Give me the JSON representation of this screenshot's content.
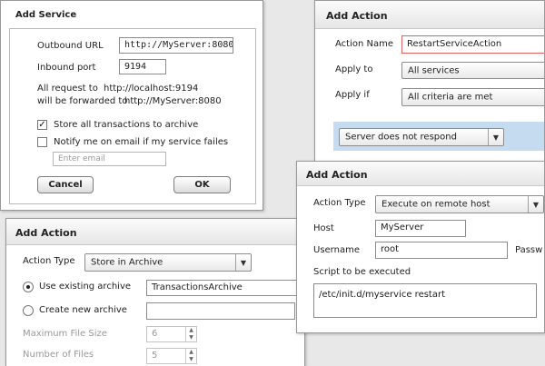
{
  "add_service": {
    "title": "Add Service",
    "outbound_label": "Outbound URL",
    "outbound_value": "http://MyServer:8080",
    "inbound_label": "Inbound port",
    "inbound_value": "9194",
    "note_line1_label": "All request to",
    "note_line1_value": "http://localhost:9194",
    "note_line2_label": "will be forwarded to",
    "note_line2_value": "http://MyServer:8080",
    "store_label": "Store all transactions to archive",
    "notify_label": "Notify me on email if my service failes",
    "email_placeholder": "Enter email",
    "cancel_label": "Cancel",
    "ok_label": "OK"
  },
  "action_top": {
    "title": "Add Action",
    "name_label": "Action Name",
    "name_value": "RestartServiceAction",
    "apply_to_label": "Apply to",
    "apply_to_value": "All services",
    "apply_if_label": "Apply if",
    "apply_if_value": "All criteria are met",
    "condition_value": "Server does not respond"
  },
  "action_archive": {
    "title": "Add Action",
    "type_label": "Action Type",
    "type_value": "Store in Archive",
    "use_existing_label": "Use existing archive",
    "existing_value": "TransactionsArchive",
    "create_new_label": "Create new archive",
    "max_size_label": "Maximum File Size",
    "max_size_value": "6",
    "num_files_label": "Number of Files",
    "num_files_value": "5"
  },
  "action_remote": {
    "title": "Add Action",
    "type_label": "Action Type",
    "type_value": "Execute on remote host",
    "host_label": "Host",
    "host_value": "MyServer",
    "username_label": "Username",
    "username_value": "root",
    "password_label": "Passw",
    "script_label": "Script to be executed",
    "script_value": "/etc/init.d/myservice restart"
  },
  "icons": {
    "dropdown": "chevron-down-icon",
    "check": "checkmark-icon",
    "spinner": "up-down-arrows-icon"
  },
  "colors": {
    "selected_field_border": "#e06060",
    "condition_band": "#c5dcf0"
  }
}
